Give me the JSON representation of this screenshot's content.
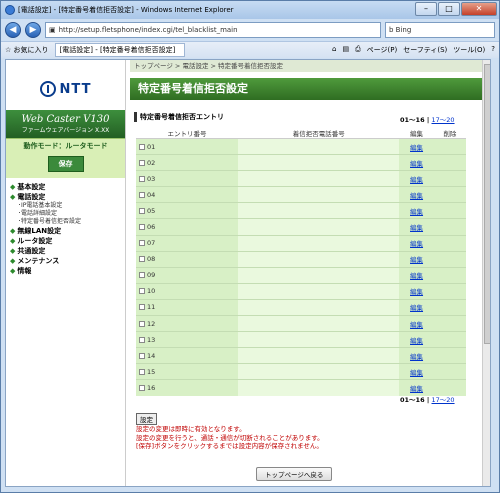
{
  "window": {
    "title": "[電話設定] - [特定番号着信拒否設定] - Windows Internet Explorer",
    "url": "http://setup.fletsphone/index.cgi/tel_blacklist_main",
    "search_placeholder": "Bing",
    "favorites_label": "お気に入り",
    "tab_label": "[電話設定] - [特定番号着信拒否設定]",
    "toolbar": {
      "page": "ページ(P)",
      "safety": "セーフティ(S)",
      "tools": "ツール(O)"
    }
  },
  "sidebar": {
    "logo": "NTT",
    "product_name": "Web Caster V130",
    "firmware": "ファームウェアバージョン X.XX",
    "mode": "動作モード：ルータモード",
    "save_label": "保存",
    "menu": [
      {
        "label": "基本設定"
      },
      {
        "label": "電話設定",
        "subs": [
          "･IP電話基本設定",
          "･電話詳細設定",
          "･特定番号着信拒否設定"
        ]
      },
      {
        "label": "無線LAN設定"
      },
      {
        "label": "ルータ設定"
      },
      {
        "label": "共通設定"
      },
      {
        "label": "メンテナンス"
      },
      {
        "label": "情報"
      }
    ]
  },
  "main": {
    "breadcrumb": "トップページ > 電話設定 > 特定番号着信拒否設定",
    "page_title": "特定番号着信拒否設定",
    "section_title": "特定番号着信拒否エントリ",
    "pager_range": "01〜16",
    "pager_next": "17〜20",
    "columns": [
      "エントリ番号",
      "着信拒否電話番号",
      "編集",
      "削除"
    ],
    "rows": [
      "01",
      "02",
      "03",
      "04",
      "05",
      "06",
      "07",
      "08",
      "09",
      "10",
      "11",
      "12",
      "13",
      "14",
      "15",
      "16"
    ],
    "edit_label": "編集",
    "set_button": "設定",
    "notes": [
      "設定の変更は即時に有効となります。",
      "設定の変更を行うと、通話・通信が切断されることがあります。",
      "[保存]ボタンをクリックするまでは設定内容が保存されません。"
    ],
    "top_button": "トップページへ戻る"
  }
}
